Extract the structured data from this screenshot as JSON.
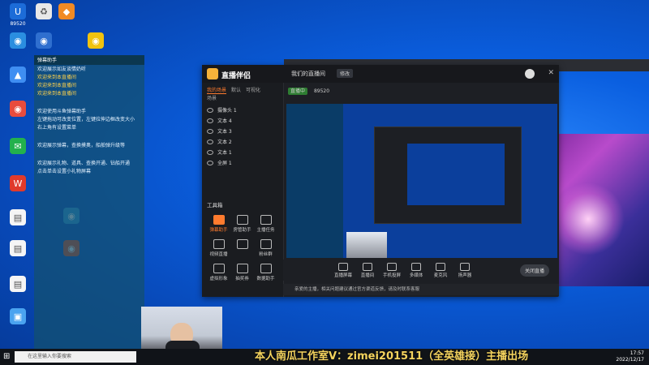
{
  "desktop_icons": [
    {
      "label": "89520",
      "color": "#1c6cd8",
      "glyph": "U"
    },
    {
      "label": "",
      "color": "#2a8ee0",
      "glyph": "◉"
    },
    {
      "label": "",
      "color": "#3f8ef2",
      "glyph": "▲"
    },
    {
      "label": "",
      "color": "#e84c3d",
      "glyph": "◉"
    },
    {
      "label": "",
      "color": "#23b14d",
      "glyph": "✉"
    },
    {
      "label": "",
      "color": "#e03a2b",
      "glyph": "W"
    },
    {
      "label": "",
      "color": "#f5f5f5",
      "glyph": "▤"
    },
    {
      "label": "",
      "color": "#f5f5f5",
      "glyph": "▤"
    },
    {
      "label": "",
      "color": "#f5f5f5",
      "glyph": "▤"
    },
    {
      "label": "",
      "color": "#4aa3f0",
      "glyph": "▣"
    },
    {
      "label": "",
      "color": "#e8e8e8",
      "glyph": "♻"
    },
    {
      "label": "",
      "color": "#f08a24",
      "glyph": "◆"
    },
    {
      "label": "",
      "color": "#2f6fcf",
      "glyph": "◉"
    },
    {
      "label": "",
      "color": "#f1c30f",
      "glyph": "◉"
    },
    {
      "label": "",
      "color": "#2f9be0",
      "glyph": "◉"
    },
    {
      "label": "",
      "color": "#e64a19",
      "glyph": "◉"
    }
  ],
  "chat": {
    "header": "弹幕助手",
    "lines": [
      {
        "text": "欢迎展示如友谈情奶听",
        "gift": false
      },
      {
        "text": "欢迎来到本直播间",
        "gift": true
      },
      {
        "text": "欢迎来到本直播间",
        "gift": true
      },
      {
        "text": "欢迎来到本直播间",
        "gift": true
      },
      {
        "text": "欢迎使用斗鱼弹幕助手",
        "gift": false
      },
      {
        "text": "左键拖动可改变位置，左键拉伸边框改变大小",
        "gift": false
      },
      {
        "text": "右上角有设置菜单",
        "gift": false
      },
      {
        "text": "欢迎展示弹幕，查换摸奥，船舶弹升级等",
        "gift": false
      },
      {
        "text": "欢迎展示礼物、道具、查换开通、钻船开通",
        "gift": false
      },
      {
        "text": "点击单击设置小礼物屏幕",
        "gift": false
      }
    ]
  },
  "app": {
    "logo": "直播伴侣",
    "tabs": [
      "我的场景",
      "默认",
      "可视化",
      "场景"
    ],
    "sources": [
      "摄像头 1",
      "文本 4",
      "文本 3",
      "文本 2",
      "文本 1",
      "全屏 1"
    ],
    "toolbox_title": "工具箱",
    "tools": [
      {
        "label": "弹幕助手",
        "hi": true
      },
      {
        "label": "房管助手",
        "hi": false
      },
      {
        "label": "主播任务",
        "hi": false
      },
      {
        "label": "视频直播",
        "hi": false
      },
      {
        "label": "",
        "hi": false
      },
      {
        "label": "粉丝群",
        "hi": false
      },
      {
        "label": "虚拟形象",
        "hi": false
      },
      {
        "label": "抽奖券",
        "hi": false
      },
      {
        "label": "数据助手",
        "hi": false
      }
    ],
    "room_title": "我们的直播间",
    "room_btn": "修改",
    "status_label": "直播中",
    "status_count": "89520",
    "bottom_buttons": [
      "直播屏幕",
      "直播间",
      "手机投屏",
      "多媒体",
      "麦克风",
      "扬声器"
    ],
    "start_button": "关闭直播",
    "notice": "亲爱的主播，相关问题建议通过官方渠道反馈，请及时联系客服"
  },
  "taskbar": {
    "search_placeholder": "在这里输入你要搜索",
    "time": "17:57",
    "date": "2022/12/17"
  },
  "watermark": "本人南瓜工作室V：zimei201511（全英雄接）主播出场"
}
